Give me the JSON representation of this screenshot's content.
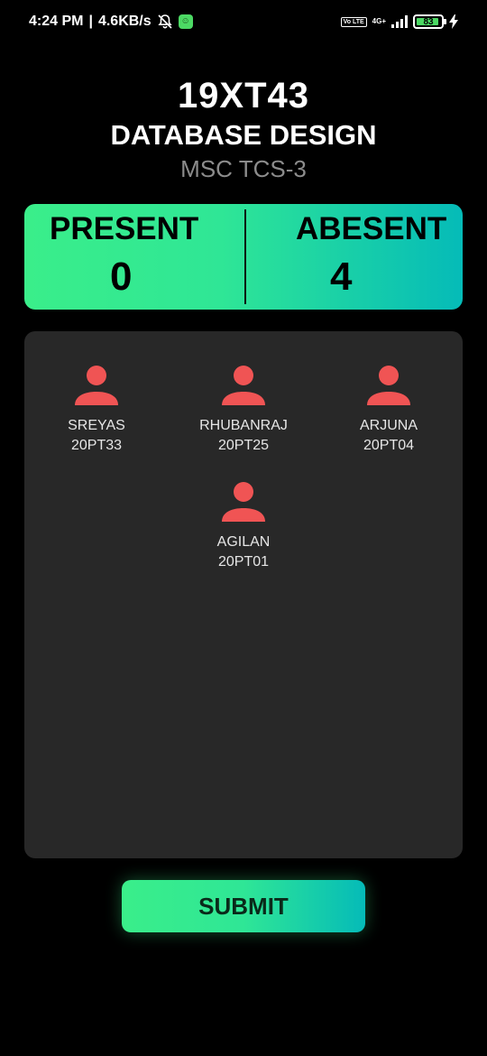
{
  "status_bar": {
    "time": "4:24 PM",
    "speed": "4.6KB/s",
    "volte": "Vo LTE",
    "network": "4G+",
    "battery": "83"
  },
  "header": {
    "course_code": "19XT43",
    "course_name": "DATABASE DESIGN",
    "class_name": "MSC TCS-3"
  },
  "summary": {
    "present_label": "PRESENT",
    "present_count": "0",
    "absent_label": "ABESENT",
    "absent_count": "4"
  },
  "students": [
    {
      "name": "SREYAS",
      "roll": "20PT33"
    },
    {
      "name": "RHUBANRAJ",
      "roll": "20PT25"
    },
    {
      "name": "ARJUNA",
      "roll": "20PT04"
    },
    {
      "name": "AGILAN",
      "roll": "20PT01"
    }
  ],
  "submit_label": "SUBMIT",
  "colors": {
    "accent_start": "#3aee8a",
    "accent_end": "#05bbb8",
    "absent_avatar": "#f05454",
    "panel_bg": "#282828"
  }
}
